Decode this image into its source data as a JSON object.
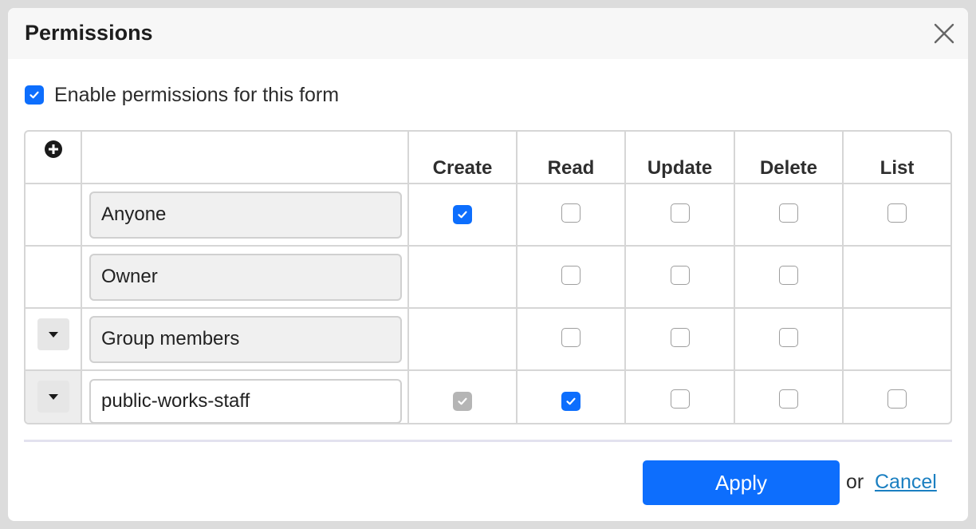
{
  "dialog": {
    "title": "Permissions",
    "close_icon": "close-icon"
  },
  "enable": {
    "label": "Enable permissions for this form",
    "checked": true
  },
  "table": {
    "add_icon": "plus-circle-icon",
    "columns": [
      "Create",
      "Read",
      "Update",
      "Delete",
      "List"
    ],
    "rows": [
      {
        "name": "Anyone",
        "editable": false,
        "has_dropdown": false,
        "perms": [
          "on",
          "off",
          "off",
          "off",
          "off"
        ]
      },
      {
        "name": "Owner",
        "editable": false,
        "has_dropdown": false,
        "perms": [
          "none",
          "off",
          "off",
          "off",
          "none"
        ]
      },
      {
        "name": "Group members",
        "editable": false,
        "has_dropdown": true,
        "perms": [
          "none",
          "off",
          "off",
          "off",
          "none"
        ]
      },
      {
        "name": "public-works-staff",
        "editable": true,
        "has_dropdown": true,
        "perms": [
          "disabled",
          "on",
          "off",
          "off",
          "off"
        ]
      }
    ]
  },
  "footer": {
    "apply_label": "Apply",
    "or_text": "or",
    "cancel_label": "Cancel"
  },
  "colors": {
    "accent": "#0d6efd",
    "link": "#1a7fc1",
    "disabled_check": "#b5b5b5"
  }
}
